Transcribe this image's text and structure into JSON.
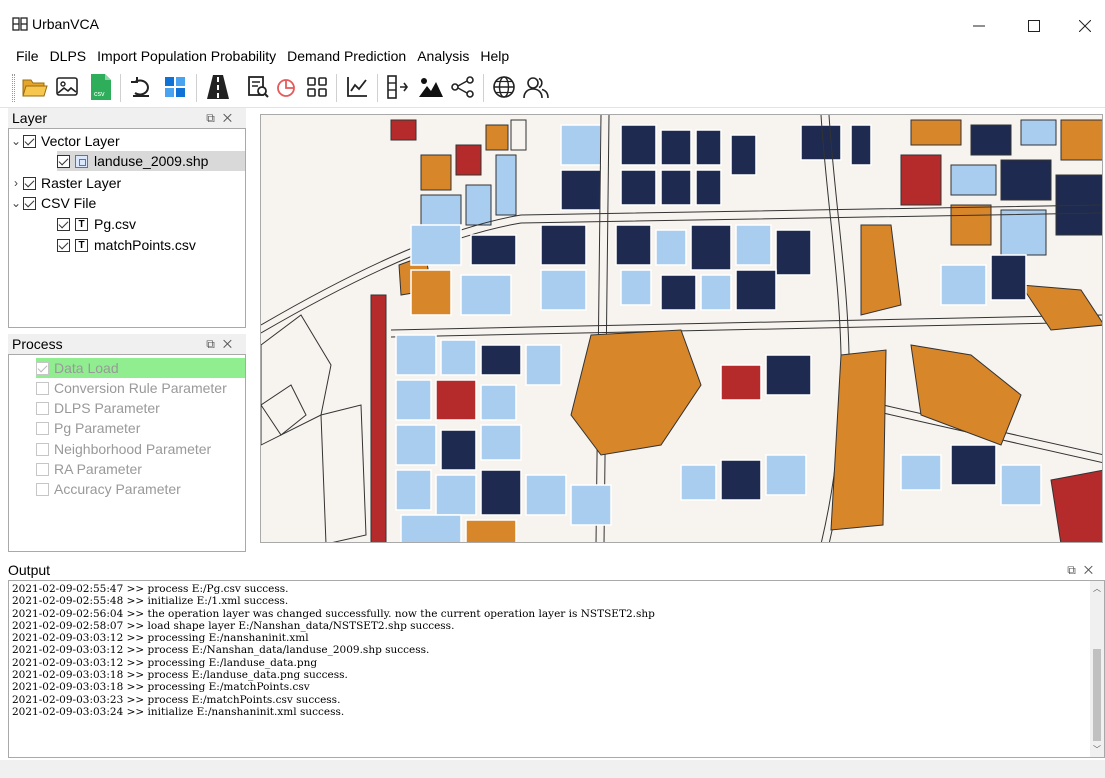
{
  "window": {
    "title": "UrbanVCA",
    "controls": [
      "minimize-icon",
      "maximize-icon",
      "close-icon"
    ]
  },
  "menu": [
    "File",
    "DLPS",
    "Import Population Probability",
    "Demand Prediction",
    "Analysis",
    "Help"
  ],
  "toolbar": {
    "icons": [
      "open-folder-icon",
      "image-icon",
      "csv-icon",
      "undo-icon",
      "windows-icon",
      "road-icon",
      "report-icon",
      "pie-chart-icon",
      "grid-icon",
      "line-chart-icon",
      "split-icon",
      "mountain-icon",
      "share-icon",
      "globe-icon",
      "users-icon"
    ],
    "csv_badge": "csv"
  },
  "layer_panel": {
    "title": "Layer",
    "items": [
      {
        "label": "Vector Layer",
        "checked": true,
        "expanded": true
      },
      {
        "label": "landuse_2009.shp",
        "checked": true,
        "selected": true
      },
      {
        "label": "Raster Layer",
        "checked": true,
        "expanded": false
      },
      {
        "label": "CSV File",
        "checked": true,
        "expanded": true
      },
      {
        "label": "Pg.csv",
        "checked": true,
        "icon_text": "T"
      },
      {
        "label": "matchPoints.csv",
        "checked": true,
        "icon_text": "T"
      }
    ]
  },
  "process_panel": {
    "title": "Process",
    "items": [
      {
        "label": "Data Load",
        "checked": true,
        "highlighted": true
      },
      {
        "label": "Conversion Rule Parameter",
        "checked": false
      },
      {
        "label": "DLPS Parameter",
        "checked": false
      },
      {
        "label": "Pg Parameter",
        "checked": false
      },
      {
        "label": "Neighborhood Parameter",
        "checked": false
      },
      {
        "label": "RA Parameter",
        "checked": false
      },
      {
        "label": "Accuracy Parameter",
        "checked": false
      }
    ]
  },
  "map": {
    "colors": {
      "residential_dark": "#1e2a4f",
      "light_blue": "#a9cdef",
      "orange": "#d8862a",
      "red": "#b52b2b",
      "background": "#f7f3ef"
    }
  },
  "output_panel": {
    "title": "Output",
    "lines": [
      "2021-02-09-02:55:47 >> process E:/Pg.csv success.",
      "2021-02-09-02:55:48 >> initialize E:/1.xml success.",
      "2021-02-09-02:56:04 >> the operation layer was changed successfully. now the current operation layer is NSTSET2.shp",
      "2021-02-09-02:58:07 >> load shape layer E:/Nanshan_data/NSTSET2.shp success.",
      "2021-02-09-03:03:12 >> processing E:/nanshaninit.xml",
      "2021-02-09-03:03:12 >> process E:/Nanshan_data/landuse_2009.shp success.",
      "2021-02-09-03:03:12 >> processing E:/landuse_data.png",
      "2021-02-09-03:03:18 >> process E:/landuse_data.png success.",
      "2021-02-09-03:03:18 >> processing E:/matchPoints.csv",
      "2021-02-09-03:03:23 >> process E:/matchPoints.csv success.",
      "2021-02-09-03:03:24 >> initialize E:/nanshaninit.xml success."
    ]
  }
}
